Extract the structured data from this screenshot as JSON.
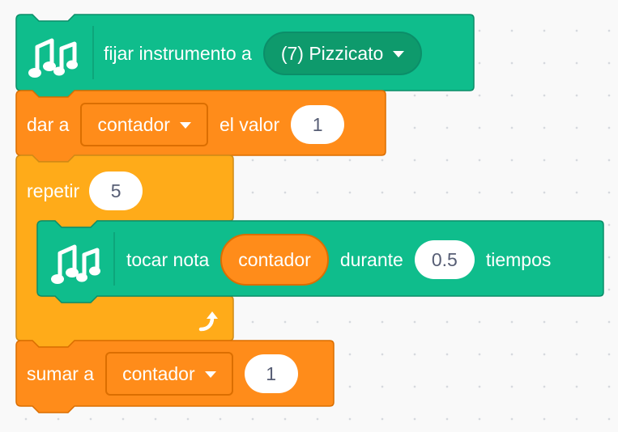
{
  "blocks": {
    "set_instrument": {
      "label": "fijar instrumento a",
      "dropdown_value": "(7) Pizzicato",
      "icon": "music-notes-icon"
    },
    "set_variable": {
      "label_start": "dar a",
      "variable": "contador",
      "label_mid": "el valor",
      "value": "1"
    },
    "repeat": {
      "label": "repetir",
      "times": "5",
      "loop_icon": "loop-arrow-icon"
    },
    "play_note": {
      "label_start": "tocar nota",
      "note_reporter": "contador",
      "label_mid": "durante",
      "beats": "0.5",
      "label_end": "tiempos",
      "icon": "music-notes-icon"
    },
    "change_variable": {
      "label_start": "sumar a",
      "variable": "contador",
      "value": "1"
    }
  },
  "colors": {
    "music_block": "#0fbd8c",
    "music_border": "#0b8e69",
    "variable_block": "#ff8c1a",
    "variable_border": "#db6e00",
    "control_block": "#ffab19",
    "control_border": "#cf8b17",
    "text_dark": "#575e75"
  }
}
